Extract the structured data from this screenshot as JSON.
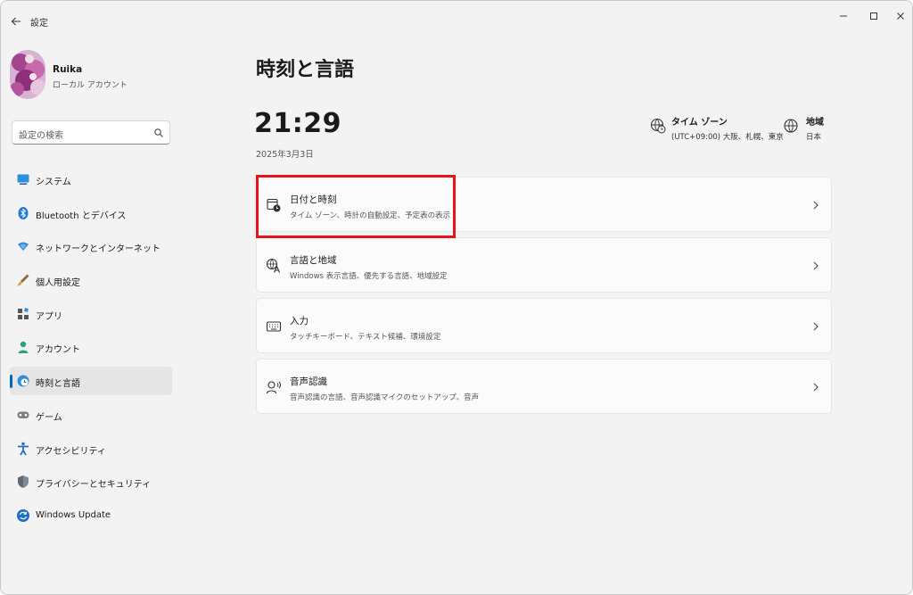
{
  "window": {
    "title": "設定"
  },
  "profile": {
    "name": "Ruika",
    "account_type": "ローカル アカウント"
  },
  "search": {
    "placeholder": "設定の検索"
  },
  "sidebar": {
    "items": [
      {
        "label": "システム",
        "icon": "system-monitor-icon",
        "selected": false
      },
      {
        "label": "Bluetooth とデバイス",
        "icon": "bluetooth-icon",
        "selected": false
      },
      {
        "label": "ネットワークとインターネット",
        "icon": "wifi-diamond-icon",
        "selected": false
      },
      {
        "label": "個人用設定",
        "icon": "brush-icon",
        "selected": false
      },
      {
        "label": "アプリ",
        "icon": "apps-icon",
        "selected": false
      },
      {
        "label": "アカウント",
        "icon": "person-icon",
        "selected": false
      },
      {
        "label": "時刻と言語",
        "icon": "globe-clock-icon",
        "selected": true
      },
      {
        "label": "ゲーム",
        "icon": "gamepad-icon",
        "selected": false
      },
      {
        "label": "アクセシビリティ",
        "icon": "accessibility-icon",
        "selected": false
      },
      {
        "label": "プライバシーとセキュリティ",
        "icon": "shield-icon",
        "selected": false
      },
      {
        "label": "Windows Update",
        "icon": "update-icon",
        "selected": false
      }
    ]
  },
  "main": {
    "title": "時刻と言語",
    "time": "21:29",
    "date": "2025年3月3日",
    "timezone": {
      "label": "タイム ゾーン",
      "value": "(UTC+09:00) 大阪、札幌、東京"
    },
    "region": {
      "label": "地域",
      "value": "日本"
    },
    "cards": [
      {
        "title": "日付と時刻",
        "subtitle": "タイム ゾーン、時計の自動設定、予定表の表示",
        "icon": "calendar-clock-icon"
      },
      {
        "title": "言語と地域",
        "subtitle": "Windows 表示言語、優先する言語、地域設定",
        "icon": "language-icon"
      },
      {
        "title": "入力",
        "subtitle": "タッチキーボード、テキスト候補、環境設定",
        "icon": "keyboard-icon"
      },
      {
        "title": "音声認識",
        "subtitle": "音声認識の言語、音声認識マイクのセットアップ、音声",
        "icon": "speech-icon"
      }
    ]
  },
  "colors": {
    "accent": "#0067c0",
    "highlight": "#e8141a",
    "background": "#f3f3f3"
  }
}
